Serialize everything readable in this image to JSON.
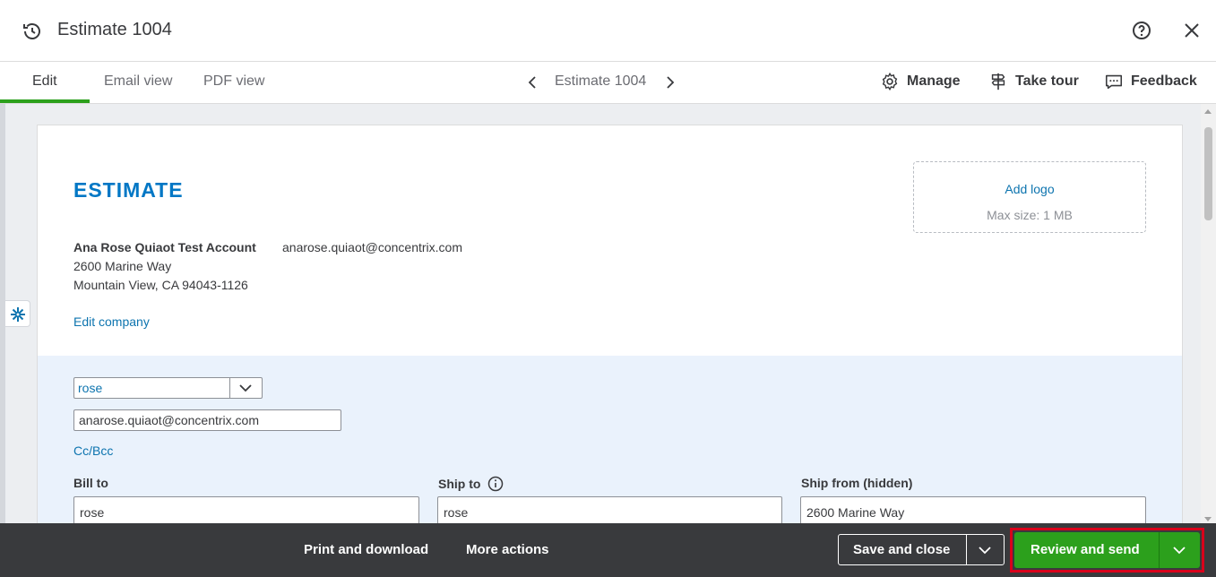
{
  "header": {
    "title": "Estimate 1004"
  },
  "tabs": [
    {
      "label": "Edit"
    },
    {
      "label": "Email view"
    },
    {
      "label": "PDF view"
    }
  ],
  "navigator": {
    "label": "Estimate 1004"
  },
  "tools": {
    "manage": "Manage",
    "take_tour": "Take tour",
    "feedback": "Feedback"
  },
  "document": {
    "heading": "ESTIMATE",
    "company_name": "Ana Rose Quiaot Test Account",
    "company_email": "anarose.quiaot@concentrix.com",
    "address_line1": "2600 Marine Way",
    "address_line2": "Mountain View, CA 94043-1126",
    "edit_company": "Edit company",
    "logo_add": "Add logo",
    "logo_max": "Max size: 1 MB"
  },
  "customer": {
    "selected": "rose",
    "email": "anarose.quiaot@concentrix.com",
    "cc_bcc": "Cc/Bcc",
    "bill_to_label": "Bill to",
    "bill_to_value": "rose",
    "ship_to_label": "Ship to",
    "ship_to_value": "rose",
    "ship_from_label": "Ship from (hidden)",
    "ship_from_value": "2600 Marine Way"
  },
  "footer": {
    "print_download": "Print and download",
    "more_actions": "More actions",
    "save_close": "Save and close",
    "review_send": "Review and send"
  },
  "colors": {
    "brand_green": "#2ca01c",
    "link_blue": "#0d74af",
    "heading_blue": "#0077c5",
    "footer_bg": "#393a3d",
    "highlight_red": "#d9001b",
    "band_bg": "#eaf2fc"
  },
  "icons": {
    "history": "history-icon",
    "help": "help-icon",
    "close": "close-icon",
    "manage": "gear-icon",
    "tour": "tour-icon",
    "feedback": "feedback-icon",
    "info": "info-icon",
    "chevron": "chevron-down-icon"
  }
}
